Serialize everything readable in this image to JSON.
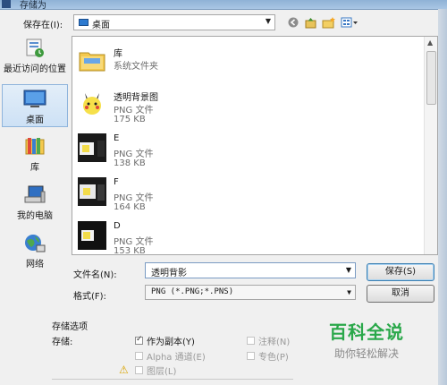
{
  "window": {
    "title": "存储为"
  },
  "location": {
    "label": "保存在(I):",
    "value": "桌面"
  },
  "toolbar": {
    "back_icon": "back-arrow-icon",
    "up_icon": "up-folder-icon",
    "new_folder_icon": "new-folder-icon",
    "view_menu_icon": "view-menu-icon"
  },
  "places": [
    {
      "label": "最近访问的位置",
      "icon": "recent-places-icon"
    },
    {
      "label": "桌面",
      "icon": "desktop-icon"
    },
    {
      "label": "库",
      "icon": "library-icon"
    },
    {
      "label": "我的电脑",
      "icon": "computer-icon"
    },
    {
      "label": "网络",
      "icon": "network-icon"
    }
  ],
  "files": [
    {
      "name": "库",
      "type": "系统文件夹",
      "size": ""
    },
    {
      "name": "透明背景图",
      "type": "PNG 文件",
      "size": "175 KB"
    },
    {
      "name": "E",
      "type": "PNG 文件",
      "size": "138 KB"
    },
    {
      "name": "F",
      "type": "PNG 文件",
      "size": "164 KB"
    },
    {
      "name": "D",
      "type": "PNG 文件",
      "size": "153 KB"
    }
  ],
  "filename": {
    "label": "文件名(N):",
    "value": "透明背影"
  },
  "filetype": {
    "label": "格式(F):",
    "value": "PNG (*.PNG;*.PNS)"
  },
  "buttons": {
    "save": "保存(S)",
    "cancel": "取消"
  },
  "options": {
    "title": "存储选项",
    "save_label": "存储:",
    "as_copy": {
      "label": "作为副本(Y)",
      "checked": true
    },
    "notes": {
      "label": "注释(N)",
      "checked": false
    },
    "alpha": {
      "label": "Alpha 通道(E)",
      "checked": false
    },
    "spot": {
      "label": "专色(P)",
      "checked": false
    },
    "layers": {
      "label": "图层(L)",
      "checked": false
    }
  },
  "watermark": {
    "title": "百科全说",
    "subtitle": "助你轻松解决"
  },
  "colors": {
    "accent": "#2aa84a",
    "selection": "#cde1f5"
  }
}
